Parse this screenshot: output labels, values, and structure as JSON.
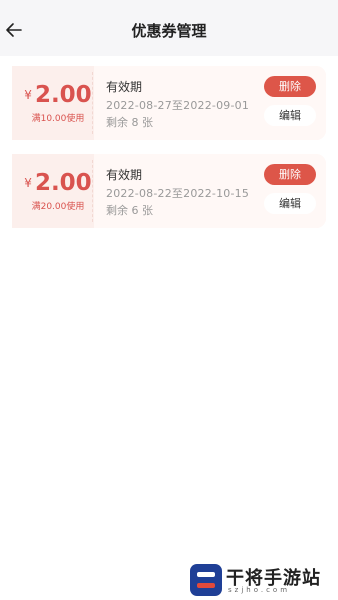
{
  "header": {
    "title": "优惠券管理",
    "back_icon": "arrow-left-icon"
  },
  "coupons": [
    {
      "currency": "¥",
      "amount": "2.00",
      "condition": "满10.00使用",
      "title": "有效期",
      "range": "2022-08-27至2022-09-01",
      "remain": "剩余 8 张",
      "delete_label": "删除",
      "edit_label": "编辑"
    },
    {
      "currency": "¥",
      "amount": "2.00",
      "condition": "满20.00使用",
      "title": "有效期",
      "range": "2022-08-22至2022-10-15",
      "remain": "剩余 6 张",
      "delete_label": "删除",
      "edit_label": "编辑"
    }
  ],
  "watermark": {
    "brand": "干将手游站",
    "domain": "szjho.com"
  },
  "colors": {
    "accent": "#dd5649",
    "coupon_bg": "#fcefec",
    "navbar_bg": "#f6f6f8"
  }
}
